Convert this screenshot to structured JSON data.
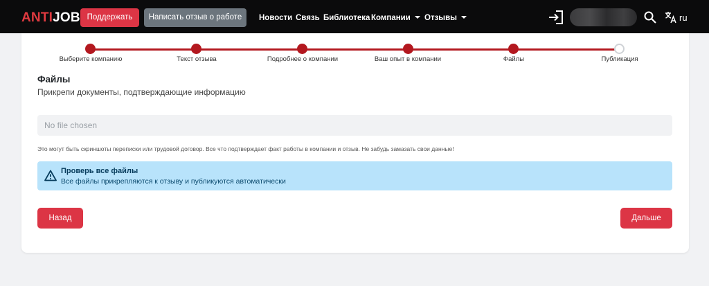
{
  "header": {
    "logo_anti": "ANTI",
    "logo_job": "JOB",
    "support_button": "Поддержать",
    "review_button": "Написать отзыв о работе",
    "nav": [
      "Новости",
      "Связь",
      "Библиотека",
      "Компании",
      "Отзывы"
    ],
    "language": "ru"
  },
  "stepper": {
    "steps": [
      {
        "label": "Выберите компанию",
        "done": true
      },
      {
        "label": "Текст отзыва",
        "done": true
      },
      {
        "label": "Подробнее о компании",
        "done": true
      },
      {
        "label": "Ваш опыт в компании",
        "done": true
      },
      {
        "label": "Файлы",
        "done": true
      },
      {
        "label": "Публикация",
        "done": false
      }
    ]
  },
  "section": {
    "title": "Файлы",
    "subtitle": "Прикрепи документы, подтверждающие информацию"
  },
  "file_input": {
    "value": "No file chosen"
  },
  "hint": "Это могут быть скриншоты переписки или трудовой договор. Все что подтверждает факт работы в компании и отзыв. Не забудь замазать свои данные!",
  "alert": {
    "title": "Проверь все файлы",
    "text": "Все файлы прикрепляются к отзыву и публикуются автоматически"
  },
  "buttons": {
    "back": "Назад",
    "next": "Дальше"
  },
  "colors": {
    "brand_red": "#dc3545",
    "stepper_red": "#b3181f",
    "alert_blue": "#b8e3fb",
    "navbar": "#0b0b0c"
  }
}
